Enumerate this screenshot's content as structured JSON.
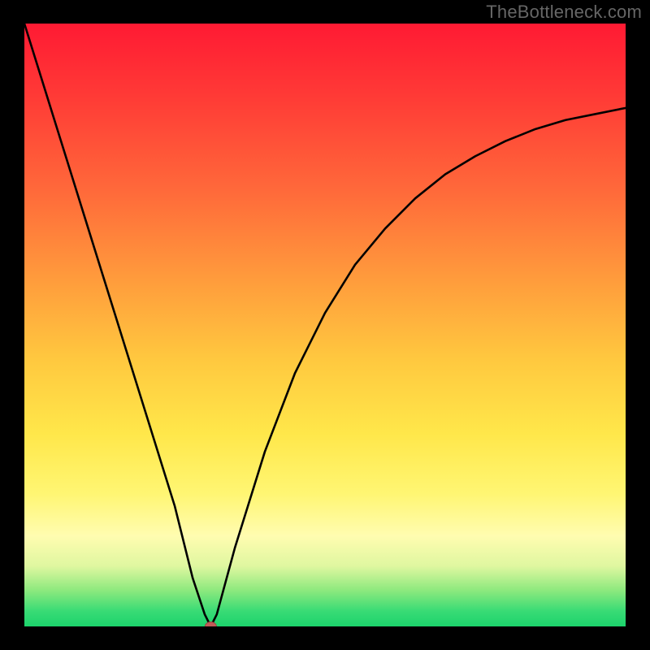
{
  "watermark": {
    "text": "TheBottleneck.com"
  },
  "chart_data": {
    "type": "line",
    "title": "",
    "xlabel": "",
    "ylabel": "",
    "xlim": [
      0,
      100
    ],
    "ylim": [
      0,
      100
    ],
    "series": [
      {
        "name": "curve",
        "x": [
          0,
          5,
          10,
          15,
          20,
          25,
          28,
          30,
          31,
          32,
          35,
          40,
          45,
          50,
          55,
          60,
          65,
          70,
          75,
          80,
          85,
          90,
          95,
          100
        ],
        "y": [
          100,
          84,
          68,
          52,
          36,
          20,
          8,
          2,
          0,
          2,
          13,
          29,
          42,
          52,
          60,
          66,
          71,
          75,
          78,
          80.5,
          82.5,
          84,
          85,
          86
        ]
      }
    ],
    "marker": {
      "x": 31,
      "y": 0,
      "shape": "oval",
      "color": "#c25a58"
    },
    "gradient_stops": [
      {
        "pos": 0.0,
        "color": "#ff1a33"
      },
      {
        "pos": 0.28,
        "color": "#ff6a3a"
      },
      {
        "pos": 0.56,
        "color": "#ffc93f"
      },
      {
        "pos": 0.78,
        "color": "#fff673"
      },
      {
        "pos": 0.9,
        "color": "#dff7a0"
      },
      {
        "pos": 1.0,
        "color": "#1cd36c"
      }
    ]
  }
}
